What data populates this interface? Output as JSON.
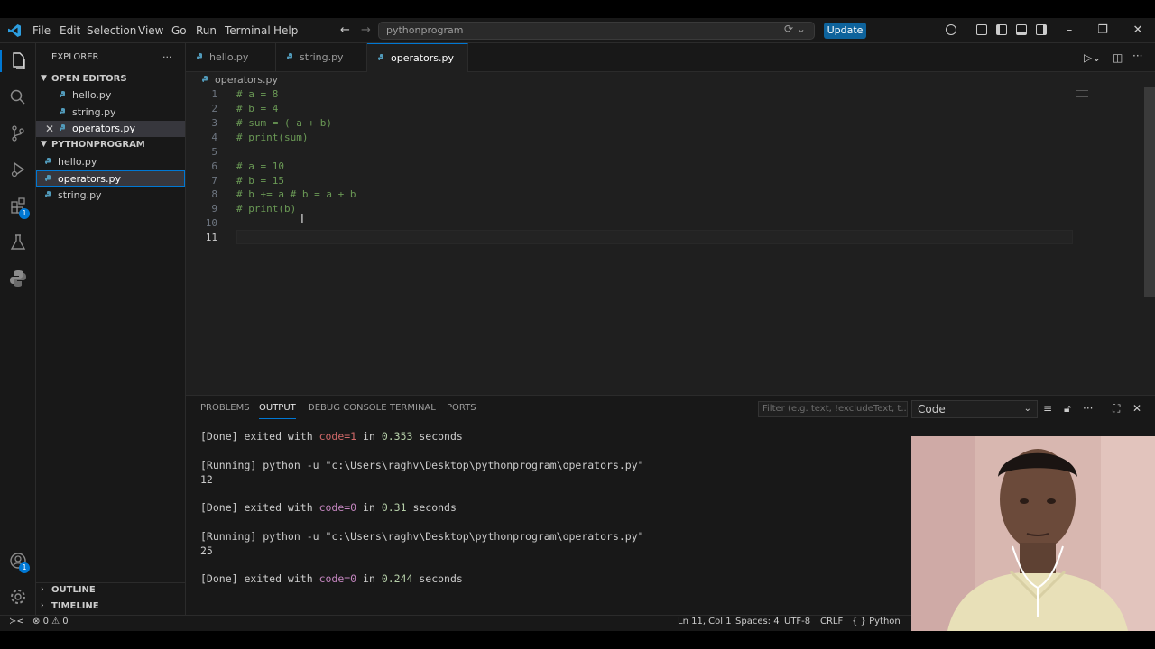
{
  "menu": [
    "File",
    "Edit",
    "Selection",
    "View",
    "Go",
    "Run",
    "Terminal",
    "Help"
  ],
  "command_center": {
    "text": "pythonprogram"
  },
  "update_button": "Update",
  "sidebar": {
    "title": "EXPLORER",
    "more": "···",
    "open_editors_header": "OPEN EDITORS",
    "open_editors": [
      "hello.py",
      "string.py",
      "operators.py"
    ],
    "folder_header": "PYTHONPROGRAM",
    "files": [
      "hello.py",
      "operators.py",
      "string.py"
    ],
    "outline": "OUTLINE",
    "timeline": "TIMELINE"
  },
  "tabs": [
    "hello.py",
    "string.py",
    "operators.py"
  ],
  "breadcrumb": "operators.py",
  "code_lines": [
    {
      "n": "1",
      "text": "# a = 8"
    },
    {
      "n": "2",
      "text": "# b = 4"
    },
    {
      "n": "3",
      "text": "# sum = ( a + b)"
    },
    {
      "n": "4",
      "text": "# print(sum)"
    },
    {
      "n": "5",
      "text": ""
    },
    {
      "n": "6",
      "text": "# a = 10"
    },
    {
      "n": "7",
      "text": "# b = 15"
    },
    {
      "n": "8",
      "text": "# b += a # b = a + b"
    },
    {
      "n": "9",
      "text": "# print(b)"
    },
    {
      "n": "10",
      "text": ""
    },
    {
      "n": "11",
      "text": ""
    }
  ],
  "panel": {
    "tabs": [
      "PROBLEMS",
      "OUTPUT",
      "DEBUG CONSOLE",
      "TERMINAL",
      "PORTS"
    ],
    "active_tab": "OUTPUT",
    "filter_placeholder": "Filter (e.g. text, !excludeText, t...",
    "channel": "Code",
    "output": {
      "l1_a": "[Done] exited with ",
      "l1_code": "code=1",
      "l1_b": " in ",
      "l1_num": "0.353",
      "l1_c": " seconds",
      "l2": "[Running] python -u \"c:\\Users\\raghv\\Desktop\\pythonprogram\\operators.py\"",
      "l3": "12",
      "l4_a": "[Done] exited with ",
      "l4_code": "code=0",
      "l4_b": " in ",
      "l4_num": "0.31",
      "l4_c": " seconds",
      "l5": "[Running] python -u \"c:\\Users\\raghv\\Desktop\\pythonprogram\\operators.py\"",
      "l6": "25",
      "l7_a": "[Done] exited with ",
      "l7_code": "code=0",
      "l7_b": " in ",
      "l7_num": "0.244",
      "l7_c": " seconds"
    }
  },
  "status": {
    "errors": "0",
    "warnings": "0",
    "position": "Ln 11, Col 1",
    "spaces": "Spaces: 4",
    "encoding": "UTF-8",
    "eol": "CRLF",
    "language": "Python"
  },
  "badges": {
    "extensions": "1",
    "accounts": "1"
  },
  "colors": {
    "accent": "#0078d4",
    "comment": "#6a9955",
    "update": "#0e639c"
  },
  "icons": [
    "files-icon",
    "search-icon",
    "source-control-icon",
    "run-debug-icon",
    "extensions-icon",
    "testing-icon",
    "python-icon",
    "accounts-icon",
    "settings-gear-icon"
  ]
}
